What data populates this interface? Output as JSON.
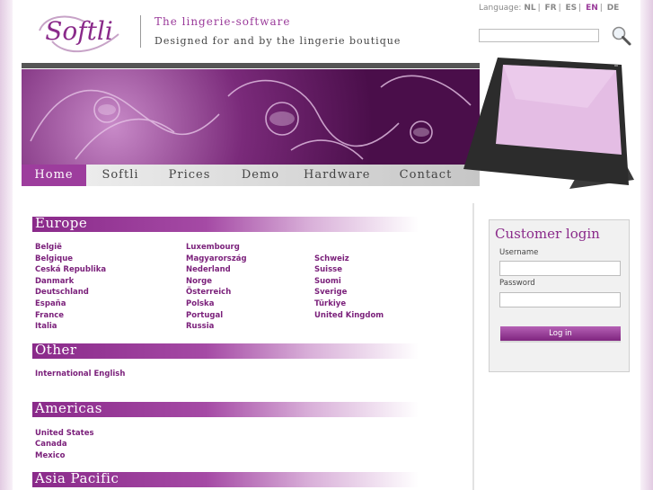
{
  "header": {
    "logo_text": "Softli",
    "tagline_primary": "The lingerie-software",
    "tagline_secondary": "Designed for and by the lingerie boutique"
  },
  "language": {
    "label": "Language:",
    "options": [
      "NL",
      "FR",
      "ES",
      "EN",
      "DE"
    ],
    "active": "EN"
  },
  "search": {
    "value": "",
    "icon": "magnifier-icon"
  },
  "nav": {
    "items": [
      "Home",
      "Softli",
      "Prices",
      "Demo",
      "Hardware",
      "Contact"
    ],
    "active": "Home"
  },
  "regions": {
    "europe": {
      "title": "Europe",
      "countries": [
        "België",
        "Belgique",
        "Ceská Republika",
        "Danmark",
        "Deutschland",
        "España",
        "France",
        "Italia",
        "Luxembourg",
        "Magyarország",
        "Nederland",
        "Norge",
        "Österreich",
        "Polska",
        "Portugal",
        "Russia",
        "Schweiz",
        "Suisse",
        "Suomi",
        "Sverige",
        "Türkiye",
        "United Kingdom"
      ]
    },
    "other": {
      "title": "Other",
      "countries": [
        "International English"
      ]
    },
    "americas": {
      "title": "Americas",
      "countries": [
        "United States",
        "Canada",
        "Mexico"
      ]
    },
    "asia_pacific": {
      "title": "Asia Pacific",
      "countries": []
    }
  },
  "login": {
    "title": "Customer login",
    "username_label": "Username",
    "username_value": "",
    "password_label": "Password",
    "password_value": "",
    "button_label": "Log in"
  },
  "colors": {
    "brand_purple": "#8a2a8a",
    "link_purple": "#7a1f7a",
    "nav_active": "#9d3d9d"
  }
}
